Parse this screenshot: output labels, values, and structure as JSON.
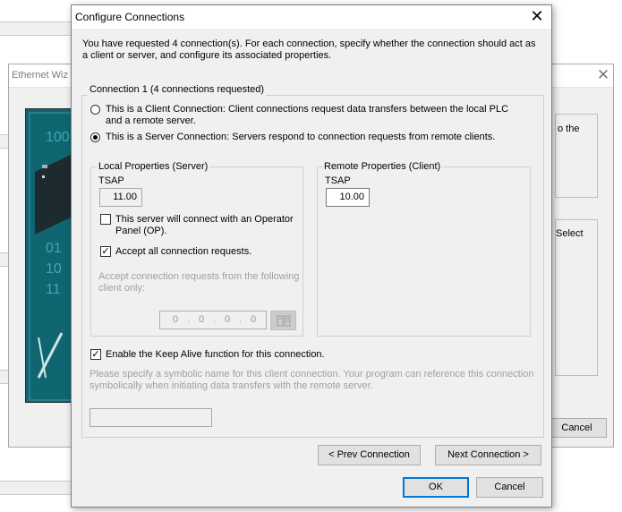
{
  "dialog": {
    "title": "Configure Connections",
    "intro": "You have requested 4 connection(s).  For each connection, specify whether the connection should act as a client or server, and configure its associated properties.",
    "connection_group_label": "Connection 1 (4 connections requested)",
    "client_radio_label": "This is a Client Connection: Client connections request data transfers between the local PLC and a remote server.",
    "server_radio_label": "This is a Server Connection: Servers respond to connection requests from remote clients.",
    "selected_mode": "server",
    "local": {
      "group_label": "Local Properties (Server)",
      "tsap_label": "TSAP",
      "tsap_value": "11.00",
      "operator_panel_label": "This server will connect with an Operator Panel (OP).",
      "operator_panel_checked": false,
      "accept_all_label": "Accept all connection requests.",
      "accept_all_checked": true,
      "accept_from_label": "Accept connection requests from the following client only:",
      "ip_octets": [
        "0",
        "0",
        "0",
        "0"
      ]
    },
    "remote": {
      "group_label": "Remote Properties (Client)",
      "tsap_label": "TSAP",
      "tsap_value": "10.00"
    },
    "keep_alive_label": "Enable the Keep Alive function for this connection.",
    "keep_alive_checked": true,
    "symbolic_name_help": "Please specify a symbolic name for this client connection.  Your program can reference this connection symbolically when initiating data transfers with the remote server.",
    "symbolic_name_value": "",
    "buttons": {
      "prev": "< Prev Connection",
      "next": "Next Connection >",
      "ok": "OK",
      "cancel": "Cancel"
    }
  },
  "wizard": {
    "title": "Ethernet Wiz",
    "side_text_1": "o the",
    "side_text_2": "Select",
    "cancel_label": "Cancel",
    "art_digits": [
      "100",
      "01",
      "10",
      "11"
    ]
  },
  "colors": {
    "window_bg": "#f0f0f0",
    "wizard_art": "#0f6670",
    "default_button_border": "#0078d7"
  }
}
